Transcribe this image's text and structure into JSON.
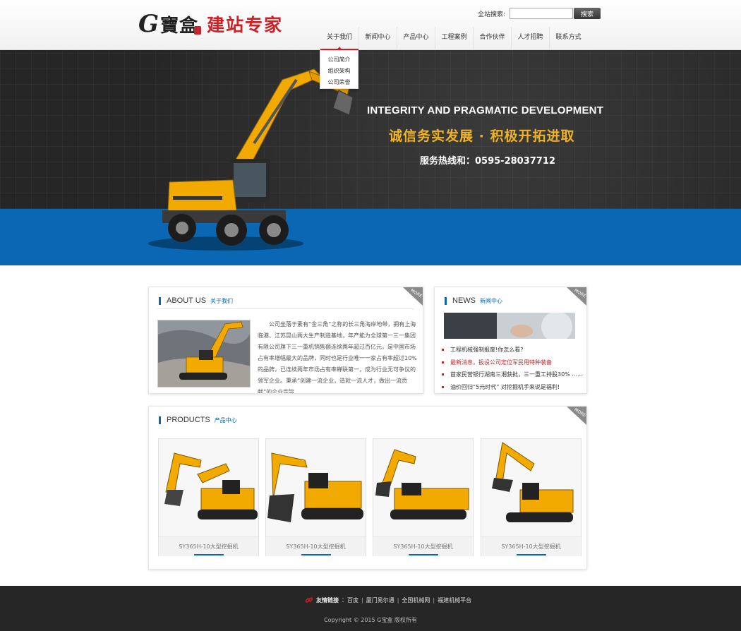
{
  "header": {
    "logo_g": "G",
    "logo_bao": "寶盒",
    "logo_slogan": "建站专家",
    "search_label": "全站搜索:",
    "search_value": "",
    "search_button": "搜索"
  },
  "nav": {
    "items": [
      "关于我们",
      "新闻中心",
      "产品中心",
      "工程案例",
      "合作伙伴",
      "人才招聘",
      "联系方式"
    ],
    "dropdown": [
      "公司简介",
      "组织架构",
      "公司荣誉"
    ]
  },
  "banner": {
    "en": "INTEGRITY AND PRAGMATIC DEVELOPMENT",
    "cn": "诚信务实发展 · 积极开拓进取",
    "hotline": "服务热线和：0595-28037712"
  },
  "about": {
    "title_en": "ABOUT US",
    "title_cn": "关于我们",
    "more": "MORE",
    "text": "公司坐落于素有“金三角”之称的长三角海岸地带，拥有上海临港、江苏昆山两大生产制造基地，年产能为全球第一三一集团有限公司旗下三一重机销售额连续两年超过百亿元，是中国市场占有率增幅最大的品牌，同时也是行业唯一一家占有率超过10%的品牌，已连续两年市场占有率蝉联第一，成为行业无可争议的领军企业。秉承“创建一流企业，造就一流人才，做出一流贡献”的企业宗旨"
  },
  "news": {
    "title_en": "NEWS",
    "title_cn": "新闻中心",
    "more": "MORE",
    "items": [
      {
        "text": "工程机械强制报废!你怎么看?",
        "highlight": false
      },
      {
        "text": "最新消息，扳设公司定位军民用特种装备",
        "highlight": true
      },
      {
        "text": "首家民营银行湖南三湘获批，三一重工持股30% ......",
        "highlight": false
      },
      {
        "text": "油价回归“5元时代” 对挖掘机手来说是福利!",
        "highlight": false
      }
    ]
  },
  "products": {
    "title_en": "PRODUCTS",
    "title_cn": "产品中心",
    "more": "MORE",
    "items": [
      {
        "name": "SY365H-10大型挖掘机"
      },
      {
        "name": "SY365H-10大型挖掘机"
      },
      {
        "name": "SY365H-10大型挖掘机"
      },
      {
        "name": "SY365H-10大型挖掘机"
      }
    ]
  },
  "footer": {
    "links_label": "友情链接",
    "links": [
      "：百度",
      "厦门易尔通",
      "全国机械网",
      "福建机械平台"
    ],
    "copyright": "Copyright © 2015 G宝盒 版权所有"
  },
  "colors": {
    "brand_blue": "#0a67b4",
    "brand_red": "#d01f25",
    "machine_yellow": "#f2a900"
  }
}
